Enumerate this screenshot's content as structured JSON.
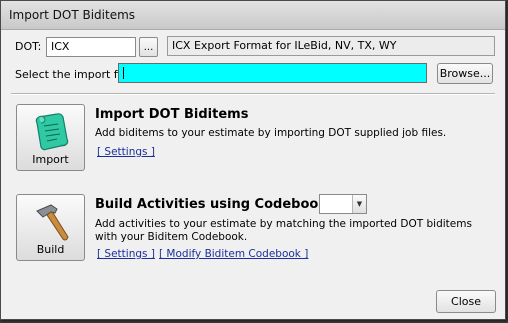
{
  "window": {
    "title": "Import DOT Biditems"
  },
  "dot": {
    "label": "DOT:",
    "value": "ICX",
    "browse_label": "...",
    "format_text": "ICX Export Format for ILeBid, NV, TX, WY"
  },
  "import_file": {
    "label": "Select the import file:",
    "value": "",
    "browse_label": "Browse...",
    "highlight_color": "#00ffff"
  },
  "import_section": {
    "button_label": "Import",
    "icon": "scroll-icon",
    "heading": "Import DOT Biditems",
    "description": "Add biditems to your estimate by importing DOT supplied job files.",
    "settings_link": "[ Settings ]"
  },
  "build_section": {
    "button_label": "Build",
    "icon": "hammer-icon",
    "heading": "Build Activities using Codebook",
    "codebook_value": "",
    "description": "Add activities to your estimate by matching the imported DOT biditems with your Biditem Codebook.",
    "settings_link": "[ Settings ]",
    "modify_link": "[ Modify Biditem Codebook ]"
  },
  "footer": {
    "close_label": "Close"
  }
}
